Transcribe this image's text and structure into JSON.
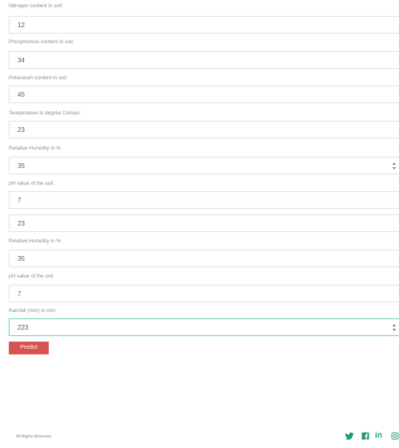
{
  "form": {
    "fields": [
      {
        "label": "Nitrogen content in soil:",
        "value": "12",
        "has_spinner": false
      },
      {
        "label": "Phosphorous content in soil:",
        "value": "34",
        "has_spinner": false
      },
      {
        "label": "Potassium content in soil:",
        "value": "45",
        "has_spinner": false
      },
      {
        "label": "Temperature in degree Celsius:",
        "value": "23",
        "has_spinner": false
      },
      {
        "label": "Relative Humidity in %",
        "value": "35",
        "has_spinner": true
      },
      {
        "label": "pH value of the soil:",
        "value": "7",
        "has_spinner": false
      },
      {
        "label": "",
        "value": "23",
        "has_spinner": false
      },
      {
        "label": "Relative Humidity in %",
        "value": "35",
        "has_spinner": false
      },
      {
        "label": "pH value of the soil:",
        "value": "7",
        "has_spinner": false
      },
      {
        "label": "Rainfall (mm) in mm:",
        "value": "223",
        "has_spinner": true,
        "focused": true
      }
    ],
    "submit_label": "Predict"
  },
  "footer": {
    "copyright": "All Rights Reserved",
    "social_icons": [
      "twitter-icon",
      "facebook-icon",
      "linkedin-icon",
      "instagram-icon"
    ],
    "linkedin_text": "in"
  },
  "colors": {
    "button": "#d9534f",
    "focus_border": "#7fcfc9",
    "social": "#1e9a7c"
  }
}
